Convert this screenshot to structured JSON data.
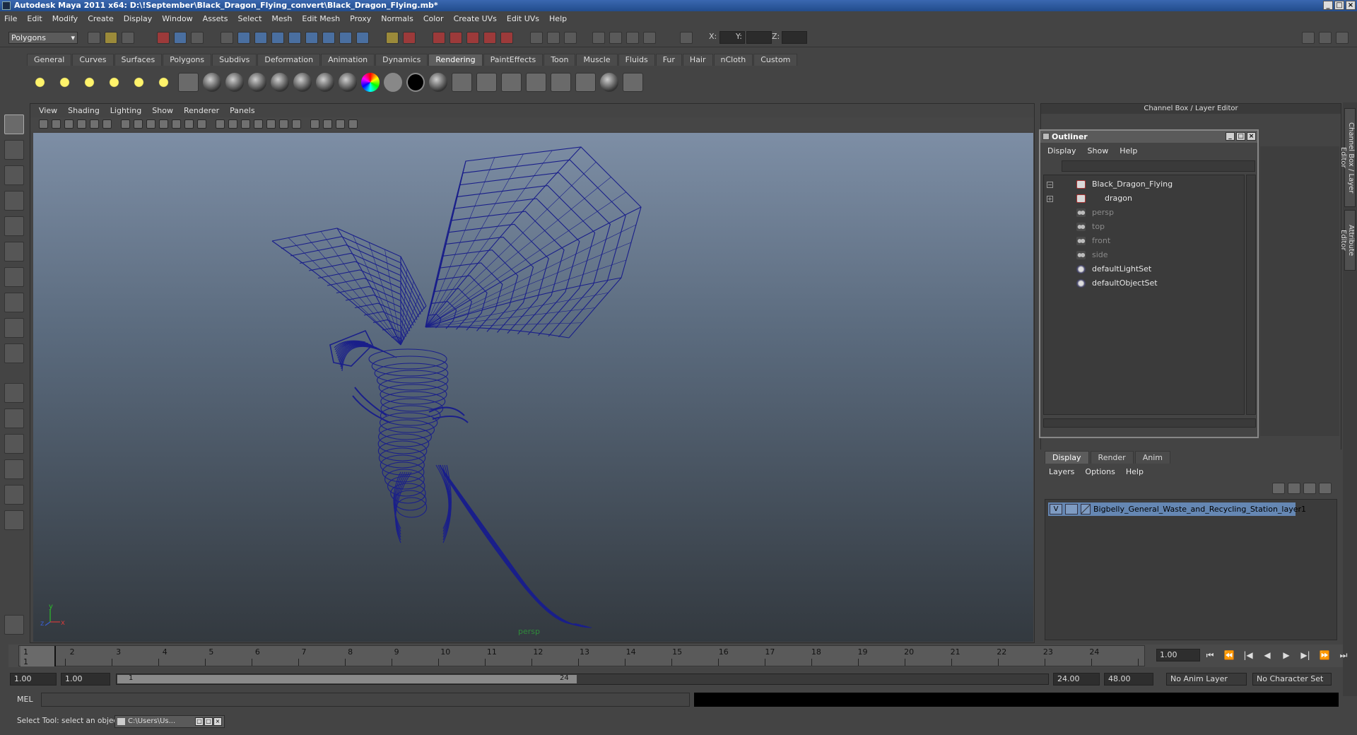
{
  "window": {
    "title": "Autodesk Maya 2011 x64: D:\\!September\\Black_Dragon_Flying_convert\\Black_Dragon_Flying.mb*",
    "controls": [
      "_",
      "□",
      "×"
    ]
  },
  "menubar": [
    "File",
    "Edit",
    "Modify",
    "Create",
    "Display",
    "Window",
    "Assets",
    "Select",
    "Mesh",
    "Edit Mesh",
    "Proxy",
    "Normals",
    "Color",
    "Create UVs",
    "Edit UVs",
    "Help"
  ],
  "status_line": {
    "mode": "Polygons",
    "x_label": "X:",
    "y_label": "Y:",
    "z_label": "Z:"
  },
  "shelf": {
    "tabs": [
      "General",
      "Curves",
      "Surfaces",
      "Polygons",
      "Subdivs",
      "Deformation",
      "Animation",
      "Dynamics",
      "Rendering",
      "PaintEffects",
      "Toon",
      "Muscle",
      "Fluids",
      "Fur",
      "Hair",
      "nCloth",
      "Custom"
    ],
    "active_tab": "Rendering"
  },
  "viewport": {
    "menu": [
      "View",
      "Shading",
      "Lighting",
      "Show",
      "Renderer",
      "Panels"
    ],
    "camera": "persp",
    "axis_y": "y",
    "axis_x": "x",
    "axis_z": "z",
    "wire_color": "#1a1f8a"
  },
  "channel_box": {
    "title": "Channel Box / Layer Editor",
    "side_tabs": [
      "Channel Box / Layer Editor",
      "Attribute Editor"
    ]
  },
  "outliner": {
    "title": "Outliner",
    "menu": [
      "Display",
      "Show",
      "Help"
    ],
    "items": [
      {
        "label": "Black_Dragon_Flying",
        "icon": "transform-icon",
        "expander": "−",
        "dim": false
      },
      {
        "label": "dragon",
        "icon": "transform-icon",
        "expander": "+",
        "dim": false
      },
      {
        "label": "persp",
        "icon": "camera-icon",
        "expander": "",
        "dim": true
      },
      {
        "label": "top",
        "icon": "camera-icon",
        "expander": "",
        "dim": true
      },
      {
        "label": "front",
        "icon": "camera-icon",
        "expander": "",
        "dim": true
      },
      {
        "label": "side",
        "icon": "camera-icon",
        "expander": "",
        "dim": true
      },
      {
        "label": "defaultLightSet",
        "icon": "set-icon",
        "expander": "",
        "dim": false
      },
      {
        "label": "defaultObjectSet",
        "icon": "set-icon",
        "expander": "",
        "dim": false
      }
    ]
  },
  "layer_editor": {
    "tabs": [
      "Display",
      "Render",
      "Anim"
    ],
    "active_tab": "Display",
    "menu": [
      "Layers",
      "Options",
      "Help"
    ],
    "layer": {
      "visible": "V",
      "name": "Bigbelly_General_Waste_and_Recycling_Station_layer1"
    }
  },
  "time_slider": {
    "ticks": [
      "1",
      "2",
      "3",
      "4",
      "5",
      "6",
      "7",
      "8",
      "9",
      "10",
      "11",
      "12",
      "13",
      "14",
      "15",
      "16",
      "17",
      "18",
      "19",
      "20",
      "21",
      "22",
      "23",
      "24"
    ],
    "current_frame_marker": "1",
    "current_frame": "1.00",
    "playback": [
      "⏮",
      "⏪",
      "|◀",
      "◀",
      "▶",
      "▶|",
      "⏩",
      "⏭"
    ]
  },
  "range_slider": {
    "start": "1.00",
    "playback_start": "1.00",
    "range_low": "1",
    "range_high": "24",
    "playback_end": "24.00",
    "end": "48.00",
    "anim_layer": "No Anim Layer",
    "character_set": "No Character Set"
  },
  "command_line": {
    "label": "MEL"
  },
  "help_line": {
    "text": "Select Tool: select an object",
    "task": "C:\\Users\\Us..."
  }
}
